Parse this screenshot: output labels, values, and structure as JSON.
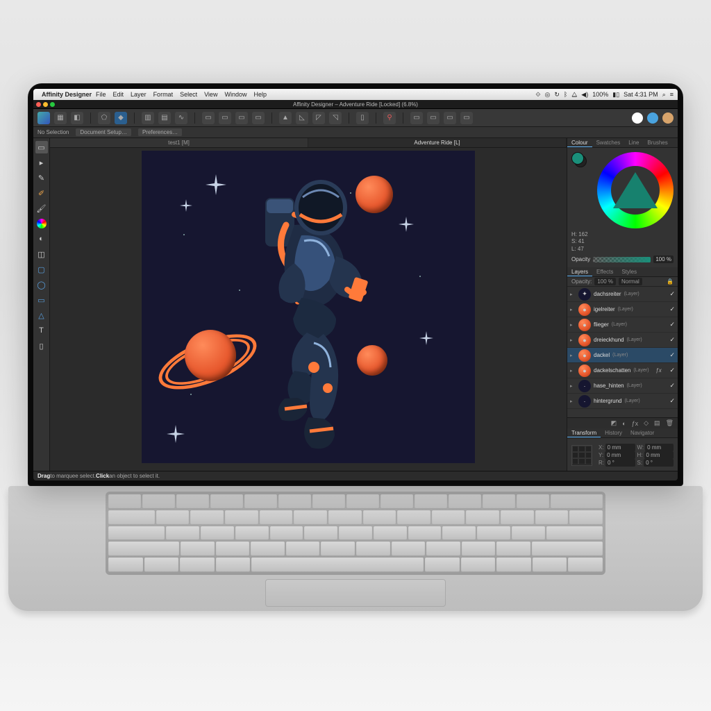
{
  "mac_menu": {
    "app": "Affinity Designer",
    "items": [
      "File",
      "Edit",
      "Layer",
      "Format",
      "Select",
      "View",
      "Window",
      "Help"
    ],
    "battery": "100%",
    "clock": "Sat 4:31 PM"
  },
  "doc_title": "Affinity Designer – Adventure Ride [Locked] (6.8%)",
  "context": {
    "selection": "No Selection",
    "doc_setup": "Document Setup…",
    "preferences": "Preferences…"
  },
  "doc_tabs": [
    {
      "label": "test1 [M]",
      "active": false
    },
    {
      "label": "Adventure Ride [L]",
      "active": true
    }
  ],
  "colour": {
    "tabs": [
      "Colour",
      "Swatches",
      "Line",
      "Brushes"
    ],
    "h": "H: 162",
    "s": "S: 41",
    "l": "L: 47",
    "opacity_label": "Opacity",
    "opacity_value": "100 %"
  },
  "layers": {
    "tabs": [
      "Layers",
      "Effects",
      "Styles"
    ],
    "opacity_label": "Opacity:",
    "opacity_value": "100 %",
    "blend_mode": "Normal",
    "items": [
      {
        "name": "dachsreiter",
        "type": "(Layer)",
        "thumb": "✦",
        "fx": false,
        "selected": false
      },
      {
        "name": "igelreiter",
        "type": "(Layer)",
        "thumb": "●",
        "fx": false,
        "selected": false
      },
      {
        "name": "flieger",
        "type": "(Layer)",
        "thumb": "●",
        "fx": false,
        "selected": false
      },
      {
        "name": "dreieckhund",
        "type": "(Layer)",
        "thumb": "●",
        "fx": false,
        "selected": false
      },
      {
        "name": "dackel",
        "type": "(Layer)",
        "thumb": "●",
        "fx": false,
        "selected": true
      },
      {
        "name": "dackelschatten",
        "type": "(Layer)",
        "thumb": "●",
        "fx": true,
        "selected": false
      },
      {
        "name": "hase_hinten",
        "type": "(Layer)",
        "thumb": "·",
        "fx": false,
        "selected": false
      },
      {
        "name": "hintergrund",
        "type": "(Layer)",
        "thumb": "·",
        "fx": false,
        "selected": false
      }
    ]
  },
  "transform": {
    "tabs": [
      "Transform",
      "History",
      "Navigator"
    ],
    "x_label": "X:",
    "x": "0 mm",
    "y_label": "Y:",
    "y": "0 mm",
    "w_label": "W:",
    "w": "0 mm",
    "h_label": "H:",
    "h": "0 mm",
    "r_label": "R:",
    "r": "0 °",
    "s_label": "S:",
    "s": "0 °"
  },
  "status": {
    "drag": "Drag",
    "drag_desc": " to marquee select. ",
    "click": "Click",
    "click_desc": " an object to select it."
  }
}
